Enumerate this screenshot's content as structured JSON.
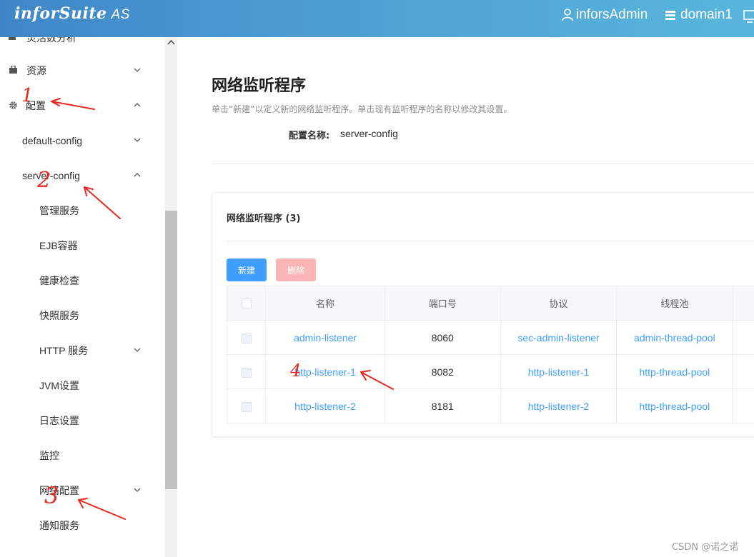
{
  "header": {
    "logo": "inforSuite",
    "logo_suffix": "AS",
    "user": "inforsAdmin",
    "domain": "domain1"
  },
  "sidebar": {
    "top_partial": "灵活数分析",
    "items": [
      {
        "label": "资源",
        "icon": "bag-icon",
        "expanded": false
      },
      {
        "label": "配置",
        "icon": "gear-icon",
        "expanded": true
      },
      {
        "label": "default-config",
        "expanded": false
      },
      {
        "label": "server-config",
        "expanded": true
      },
      {
        "label": "管理服务"
      },
      {
        "label": "EJB容器"
      },
      {
        "label": "健康检查"
      },
      {
        "label": "快照服务"
      },
      {
        "label": "HTTP 服务",
        "expanded": false
      },
      {
        "label": "JVM设置"
      },
      {
        "label": "日志设置"
      },
      {
        "label": "监控"
      },
      {
        "label": "网络配置",
        "expanded": false
      },
      {
        "label": "通知服务"
      }
    ]
  },
  "main": {
    "title": "网络监听程序",
    "description": "单击“新建”以定义新的网络监听程序。单击现有监听程序的名称以修改其设置。",
    "config_label": "配置名称:",
    "config_value": "server-config",
    "card_title": "网络监听程序 (3)",
    "new_button": "新建",
    "delete_button": "删除",
    "columns": [
      "名称",
      "端口号",
      "协议",
      "线程池"
    ],
    "rows": [
      {
        "name": "admin-listener",
        "port": "8060",
        "protocol": "sec-admin-listener",
        "pool": "admin-thread-pool"
      },
      {
        "name": "http-listener-1",
        "port": "8082",
        "protocol": "http-listener-1",
        "pool": "http-thread-pool"
      },
      {
        "name": "http-listener-2",
        "port": "8181",
        "protocol": "http-listener-2",
        "pool": "http-thread-pool"
      }
    ]
  },
  "annotations": [
    "1",
    "2",
    "3",
    "4"
  ],
  "watermark": "CSDN @诺之诺"
}
